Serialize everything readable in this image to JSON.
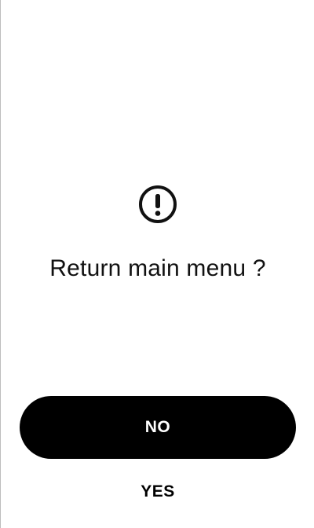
{
  "dialog": {
    "icon": "exclamation-circle-icon",
    "message": "Return main menu ?",
    "no_label": "NO",
    "yes_label": "YES"
  },
  "colors": {
    "background": "#ffffff",
    "text": "#111111",
    "primary_button_bg": "#000000",
    "primary_button_text": "#ffffff"
  }
}
